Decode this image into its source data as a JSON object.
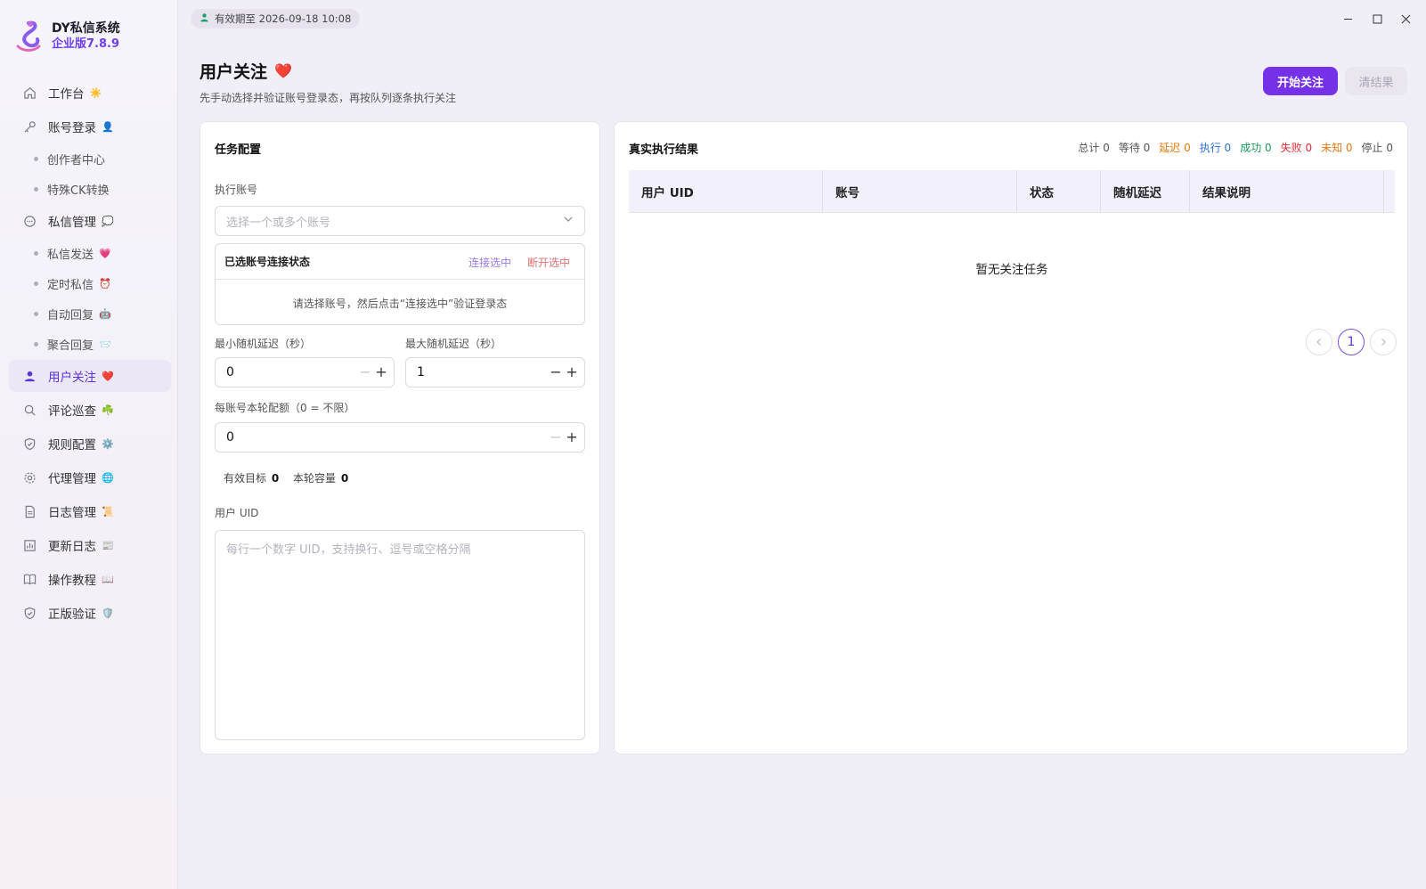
{
  "brand": {
    "title": "DY私信系统",
    "version": "企业版7.8.9"
  },
  "nav": {
    "items": [
      {
        "label": "工作台",
        "emoji": "☀️"
      },
      {
        "label": "账号登录",
        "emoji": "👤"
      },
      {
        "label": "创作者中心",
        "emoji": ""
      },
      {
        "label": "特殊CK转换",
        "emoji": ""
      },
      {
        "label": "私信管理",
        "emoji": "💭"
      },
      {
        "label": "私信发送",
        "emoji": "💗"
      },
      {
        "label": "定时私信",
        "emoji": "⏰"
      },
      {
        "label": "自动回复",
        "emoji": "🤖"
      },
      {
        "label": "聚合回复",
        "emoji": "📨"
      },
      {
        "label": "用户关注",
        "emoji": "❤️"
      },
      {
        "label": "评论巡查",
        "emoji": "☘️"
      },
      {
        "label": "规则配置",
        "emoji": "⚙️"
      },
      {
        "label": "代理管理",
        "emoji": "🌐"
      },
      {
        "label": "日志管理",
        "emoji": "📜"
      },
      {
        "label": "更新日志",
        "emoji": "📰"
      },
      {
        "label": "操作教程",
        "emoji": "📖"
      },
      {
        "label": "正版验证",
        "emoji": "🛡️"
      }
    ]
  },
  "topbar": {
    "expiry": "有效期至 2026-09-18 10:08"
  },
  "header": {
    "title": "用户关注",
    "title_emoji": "❤️",
    "subtitle": "先手动选择并验证账号登录态，再按队列逐条执行关注",
    "start_button": "开始关注",
    "clear_button": "清结果"
  },
  "config": {
    "title": "任务配置",
    "account_label": "执行账号",
    "account_placeholder": "选择一个或多个账号",
    "conn_title": "已选账号连接状态",
    "conn_connect": "连接选中",
    "conn_disconnect": "断开选中",
    "conn_empty": "请选择账号，然后点击“连接选中”验证登录态",
    "min_delay_label": "最小随机延迟（秒）",
    "min_delay_value": "0",
    "max_delay_label": "最大随机延迟（秒）",
    "max_delay_value": "1",
    "quota_label": "每账号本轮配额（0 = 不限）",
    "quota_value": "0",
    "valid_target_label": "有效目标",
    "valid_target_value": "0",
    "capacity_label": "本轮容量",
    "capacity_value": "0",
    "uid_label": "用户 UID",
    "uid_placeholder": "每行一个数字 UID，支持换行、逗号或空格分隔"
  },
  "results": {
    "title": "真实执行结果",
    "counters": [
      {
        "label": "总计 0",
        "color": "#555555"
      },
      {
        "label": "等待 0",
        "color": "#555555"
      },
      {
        "label": "延迟 0",
        "color": "#e07a10"
      },
      {
        "label": "执行 0",
        "color": "#2f6fd6"
      },
      {
        "label": "成功 0",
        "color": "#1a9a5a"
      },
      {
        "label": "失败 0",
        "color": "#e0303a"
      },
      {
        "label": "未知 0",
        "color": "#e07a10"
      },
      {
        "label": "停止 0",
        "color": "#555555"
      }
    ],
    "columns": [
      "用户 UID",
      "账号",
      "状态",
      "随机延迟",
      "结果说明"
    ],
    "empty": "暂无关注任务",
    "page": "1"
  },
  "colors": {
    "accent": "#7431e8",
    "active_nav": "#5b33d6"
  }
}
